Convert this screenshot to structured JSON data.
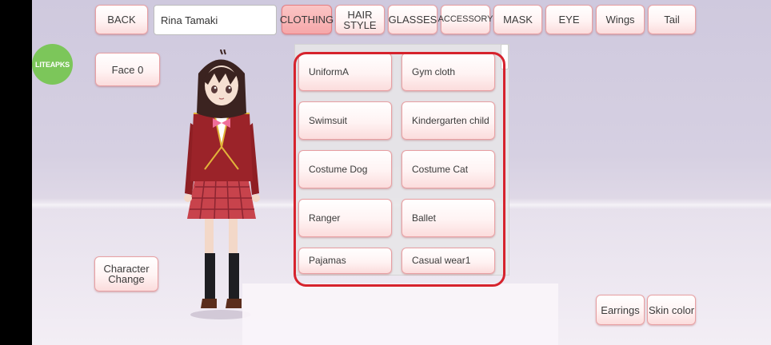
{
  "toolbar": {
    "back_label": "BACK",
    "name_value": "Rina Tamaki",
    "tabs": [
      {
        "label": "CLOTHING",
        "active": true
      },
      {
        "label": "HAIR STYLE",
        "line1": "HAIR",
        "line2": "STYLE",
        "active": false
      },
      {
        "label": "GLASSES",
        "active": false
      },
      {
        "label": "ACCESSORY",
        "active": false
      },
      {
        "label": "MASK",
        "active": false
      },
      {
        "label": "EYE",
        "active": false
      },
      {
        "label": "Wings",
        "active": false
      },
      {
        "label": "Tail",
        "active": false
      }
    ]
  },
  "watermark": "LITEAPKS",
  "left_panel": {
    "face_label": "Face 0",
    "character_change_line1": "Character",
    "character_change_line2": "Change"
  },
  "clothing_list": {
    "items": [
      "UniformA",
      "Gym cloth",
      "Swimsuit",
      "Kindergarten child",
      "Costume Dog",
      "Costume Cat",
      "Ranger",
      "Ballet",
      "Pajamas",
      "Casual wear1"
    ]
  },
  "bottom_right": {
    "earrings_label": "Earrings",
    "skin_color_label": "Skin color"
  },
  "colors": {
    "button_border": "#e8a0a3",
    "active_tab": "#f6a7a9",
    "highlight": "#d6232d",
    "watermark_bg": "#7cc65a"
  }
}
